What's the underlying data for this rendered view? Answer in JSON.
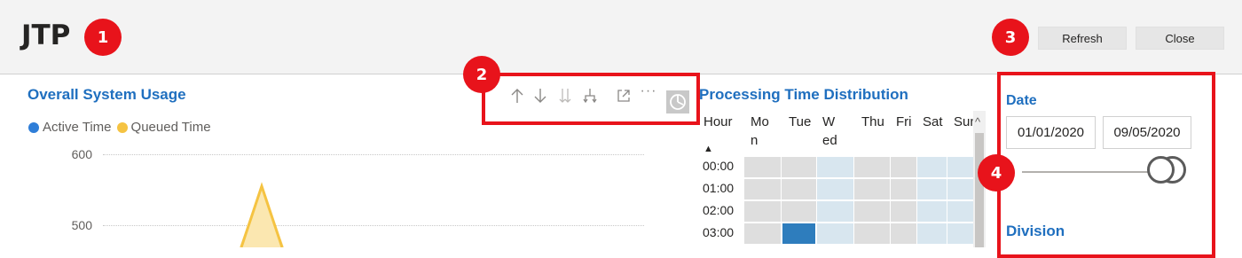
{
  "header": {
    "title": "JTP",
    "refresh_label": "Refresh",
    "close_label": "Close"
  },
  "markers": [
    "1",
    "2",
    "3",
    "4"
  ],
  "chart1": {
    "title": "Overall System Usage",
    "legend": [
      {
        "name": "Active Time",
        "color": "#2f7ed8"
      },
      {
        "name": "Queued Time",
        "color": "#f5c342"
      }
    ],
    "yticks": [
      "600",
      "500"
    ]
  },
  "toolbar": {
    "icons": [
      "arrow-up-icon",
      "arrow-down-icon",
      "double-arrow-down-icon",
      "expand-hierarchy-icon",
      "focus-mode-icon",
      "more-options-icon",
      "spotlight-icon"
    ],
    "more_label": "···"
  },
  "chart2": {
    "title": "Processing Time Distribution",
    "columns": [
      "Hour",
      "Mon",
      "Tue",
      "Wed",
      "Thu",
      "Fri",
      "Sat",
      "Sun"
    ],
    "rows": [
      "00:00",
      "01:00",
      "02:00",
      "03:00"
    ],
    "sort_indicator": "▲",
    "scroll_up": "^",
    "colors": {
      "none": "#dedede",
      "light": "#d8e6ef",
      "lighter": "#d4e4ef",
      "dark": "#2e7dbd"
    },
    "cells": [
      [
        "none",
        "none",
        "light",
        "none",
        "none",
        "light",
        "light"
      ],
      [
        "none",
        "none",
        "light",
        "none",
        "none",
        "light",
        "light"
      ],
      [
        "none",
        "none",
        "light",
        "none",
        "none",
        "light",
        "light"
      ],
      [
        "none",
        "dark",
        "light",
        "none",
        "none",
        "light",
        "light"
      ]
    ]
  },
  "slicer": {
    "date_title": "Date",
    "start_date": "01/01/2020",
    "end_date": "09/05/2020",
    "division_title": "Division"
  }
}
